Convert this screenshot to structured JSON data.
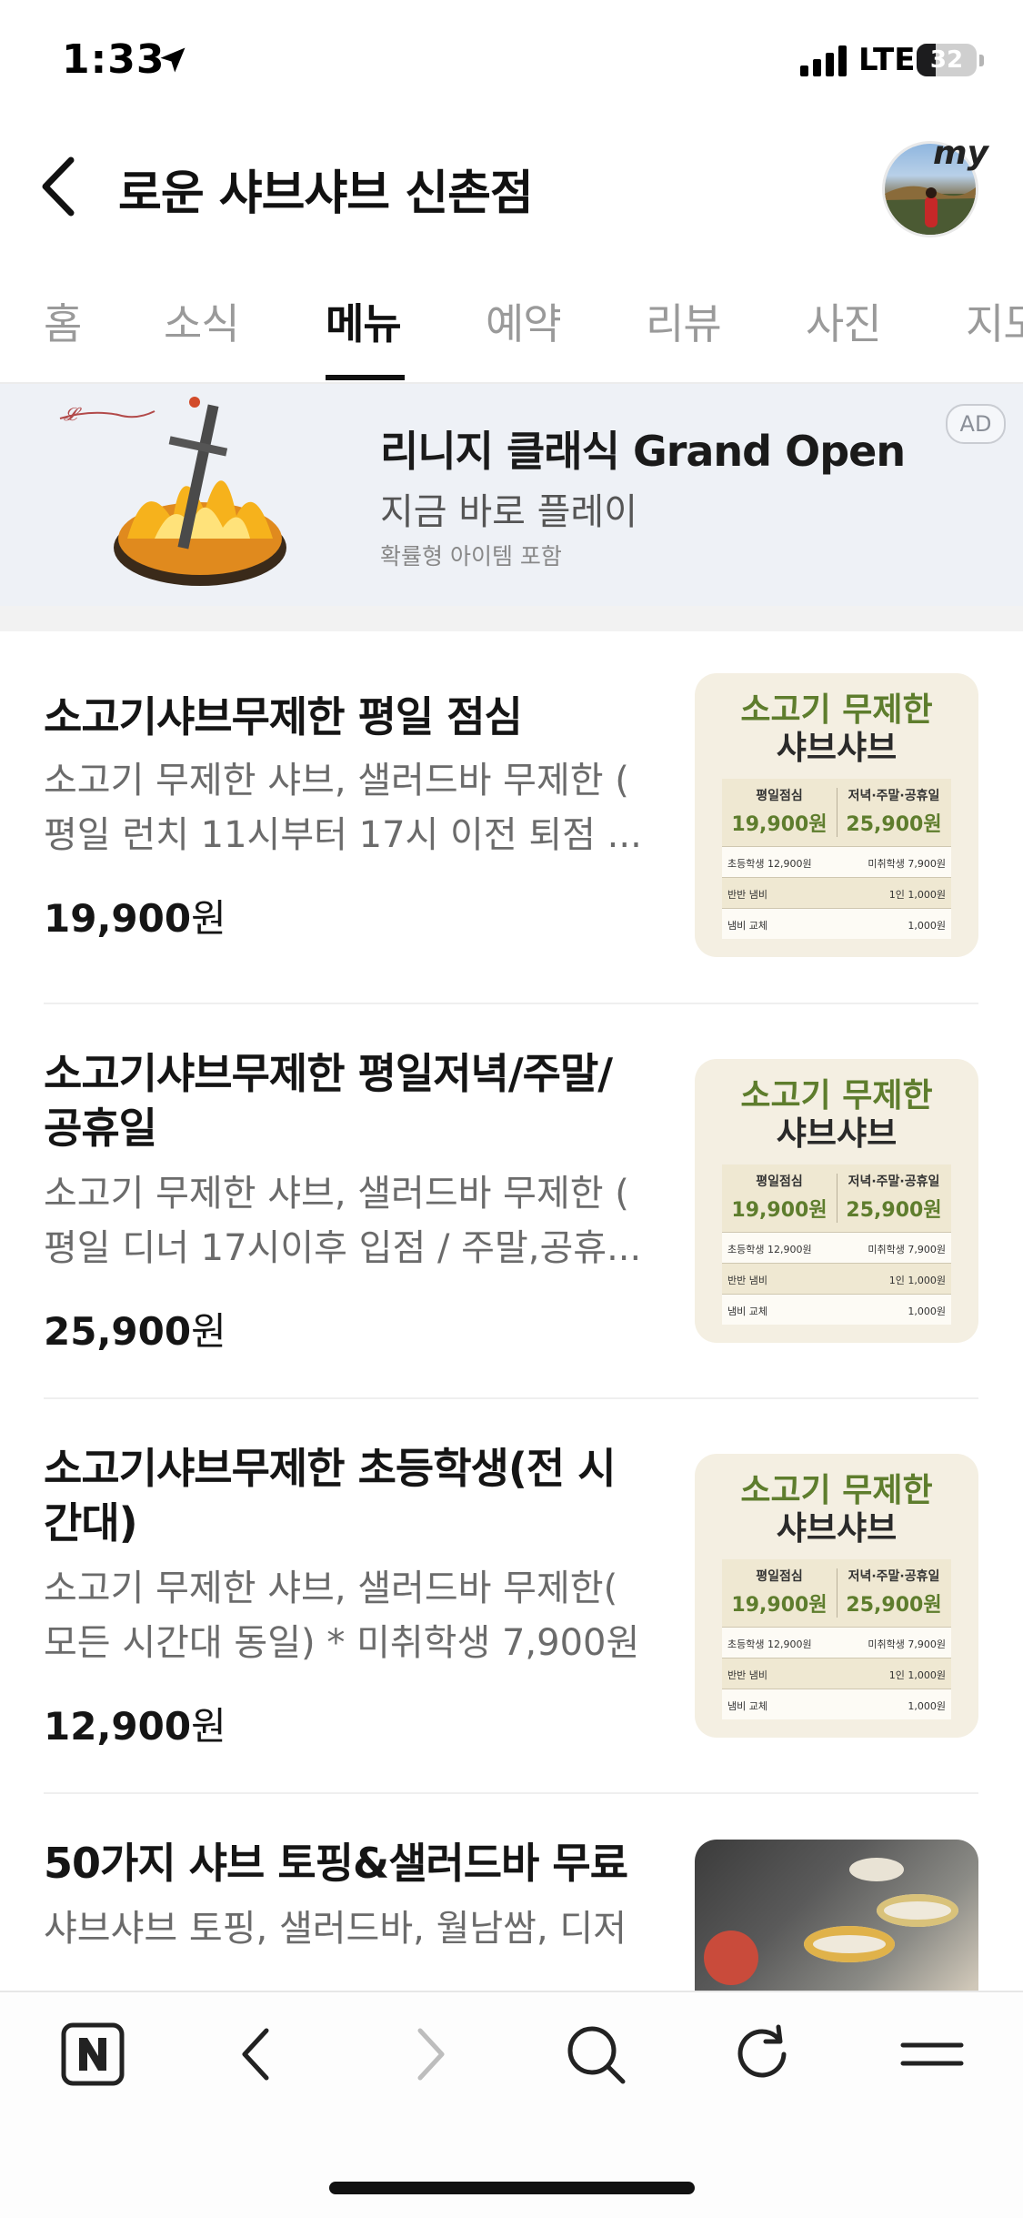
{
  "status_bar": {
    "time": "1:33",
    "network": "LTE",
    "battery_level": "32",
    "battery_percent": 32
  },
  "header": {
    "title": "로운 샤브샤브 신촌점",
    "avatar_badge": "my"
  },
  "tabs": [
    {
      "label": "홈"
    },
    {
      "label": "소식"
    },
    {
      "label": "메뉴",
      "active": true
    },
    {
      "label": "예약"
    },
    {
      "label": "리뷰"
    },
    {
      "label": "사진"
    },
    {
      "label": "지도"
    }
  ],
  "ad": {
    "title": "리니지 클래식 Grand Open",
    "subtitle": "지금 바로 플레이",
    "note": "확률형 아이템 포함",
    "badge": "AD"
  },
  "poster": {
    "title_line1": "소고기 무제한",
    "title_line2": "샤브샤브",
    "col_a_label": "평일점심",
    "col_a_price": "19,900원",
    "col_b_label": "저녁·주말·공휴일",
    "col_b_price": "25,900원",
    "row1_left": "초등학생  12,900원",
    "row1_right": "미취학생  7,900원",
    "row2_left": "반반 냄비",
    "row2_right": "1인 1,000원",
    "row3_left": "냄비 교체",
    "row3_right": "1,000원"
  },
  "menu_items": [
    {
      "name": "소고기샤브무제한 평일 점심",
      "desc_line1": "소고기 무제한 샤브, 샐러드바 무제한 (",
      "desc_line2": "평일 런치 11시부터 17시 이전 퇴점 ...",
      "price": "19,900",
      "currency": "원"
    },
    {
      "name_line1": "소고기샤브무제한 평일저녁/주말/",
      "name_line2": "공휴일",
      "desc_line1": "소고기 무제한 샤브, 샐러드바 무제한 (",
      "desc_line2": "평일 디너 17시이후 입점 / 주말,공휴...",
      "price": "25,900",
      "currency": "원"
    },
    {
      "name_line1": "소고기샤브무제한 초등학생(전 시",
      "name_line2": "간대)",
      "desc_line1": "소고기 무제한 샤브, 샐러드바 무제한(",
      "desc_line2": "모든 시간대 동일) * 미취학생 7,900원",
      "price": "12,900",
      "currency": "원"
    },
    {
      "name": "50가지 샤브 토핑&샐러드바 무료",
      "desc_line1": "샤브샤브 토핑, 샐러드바, 월남쌈, 디저"
    }
  ],
  "icons": {
    "location": "location-arrow-icon",
    "signal": "signal-bars-icon",
    "back": "chevron-left-icon",
    "naver": "naver-n-icon",
    "forward": "chevron-right-icon",
    "search": "search-icon",
    "reload": "reload-icon",
    "menu": "hamburger-menu-icon"
  },
  "colors": {
    "poster_green": "#5e7d2d",
    "poster_bg": "#f4efe2",
    "ad_bg": "#eef1f6"
  }
}
